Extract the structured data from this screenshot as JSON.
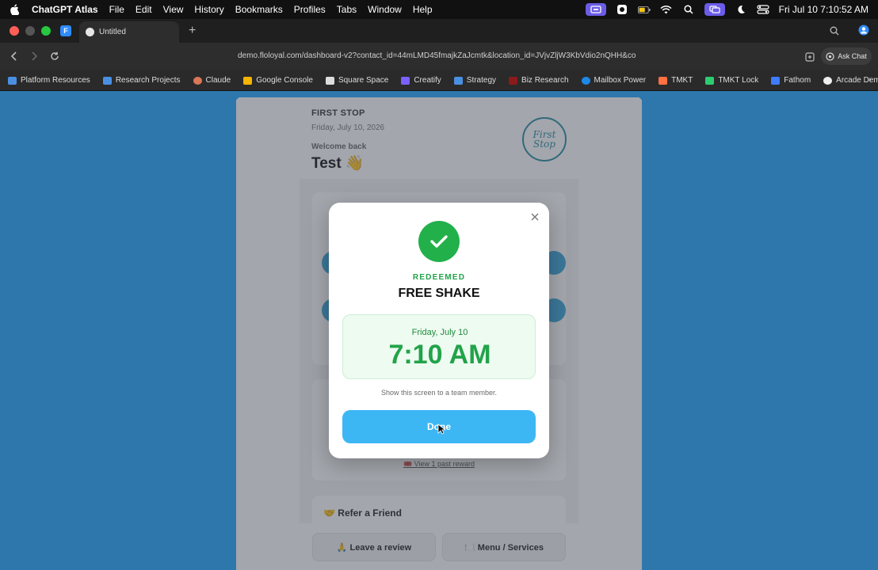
{
  "menubar": {
    "app": "ChatGPT Atlas",
    "items": [
      "File",
      "Edit",
      "View",
      "History",
      "Bookmarks",
      "Profiles",
      "Tabs",
      "Window",
      "Help"
    ],
    "clock": "Fri Jul 10  7:10:52 AM"
  },
  "browser": {
    "pinned_tab_letter": "F",
    "tab_title": "Untitled",
    "url": "demo.floloyal.com/dashboard-v2?contact_id=44mLMD45fmajkZaJcmtk&location_id=JVjvZljW3KbVdio2nQHH&co",
    "ask_chat": "Ask Chat"
  },
  "bookmarks": [
    {
      "label": "Platform Resources",
      "color": "#4a90e2"
    },
    {
      "label": "Research Projects",
      "color": "#4a90e2"
    },
    {
      "label": "Claude",
      "color": "#d97757"
    },
    {
      "label": "Google Console",
      "color": "#f4b400"
    },
    {
      "label": "Square Space",
      "color": "#dddddd"
    },
    {
      "label": "Creatify",
      "color": "#7b61ff"
    },
    {
      "label": "Strategy",
      "color": "#4a90e2"
    },
    {
      "label": "Biz Research",
      "color": "#8b1a1a"
    },
    {
      "label": "Mailbox Power",
      "color": "#1e88e5"
    },
    {
      "label": "TMKT",
      "color": "#ff7043"
    },
    {
      "label": "TMKT Lock",
      "color": "#2ecc71"
    },
    {
      "label": "Fathom",
      "color": "#3f7bff"
    },
    {
      "label": "Arcade Demo SaaS",
      "color": "#eeeeee"
    }
  ],
  "page": {
    "brand": "FIRST STOP",
    "date": "Friday, July 10, 2026",
    "welcome": "Welcome back",
    "user_name": "Test 👋",
    "logo_text": "First Stop",
    "past_reward_link": "🎟️ View 1 past reward",
    "refer_title": "🤝 Refer a Friend",
    "leave_review": "🙏 Leave a review",
    "menu_services": "🍽️ Menu / Services"
  },
  "modal": {
    "status": "REDEEMED",
    "reward": "FREE SHAKE",
    "date": "Friday, July 10",
    "time": "7:10 AM",
    "hint": "Show this screen to a team member.",
    "done": "Done"
  },
  "colors": {
    "desktop": "#2d77ad",
    "success": "#22b04b",
    "done_button": "#3db7f4"
  }
}
